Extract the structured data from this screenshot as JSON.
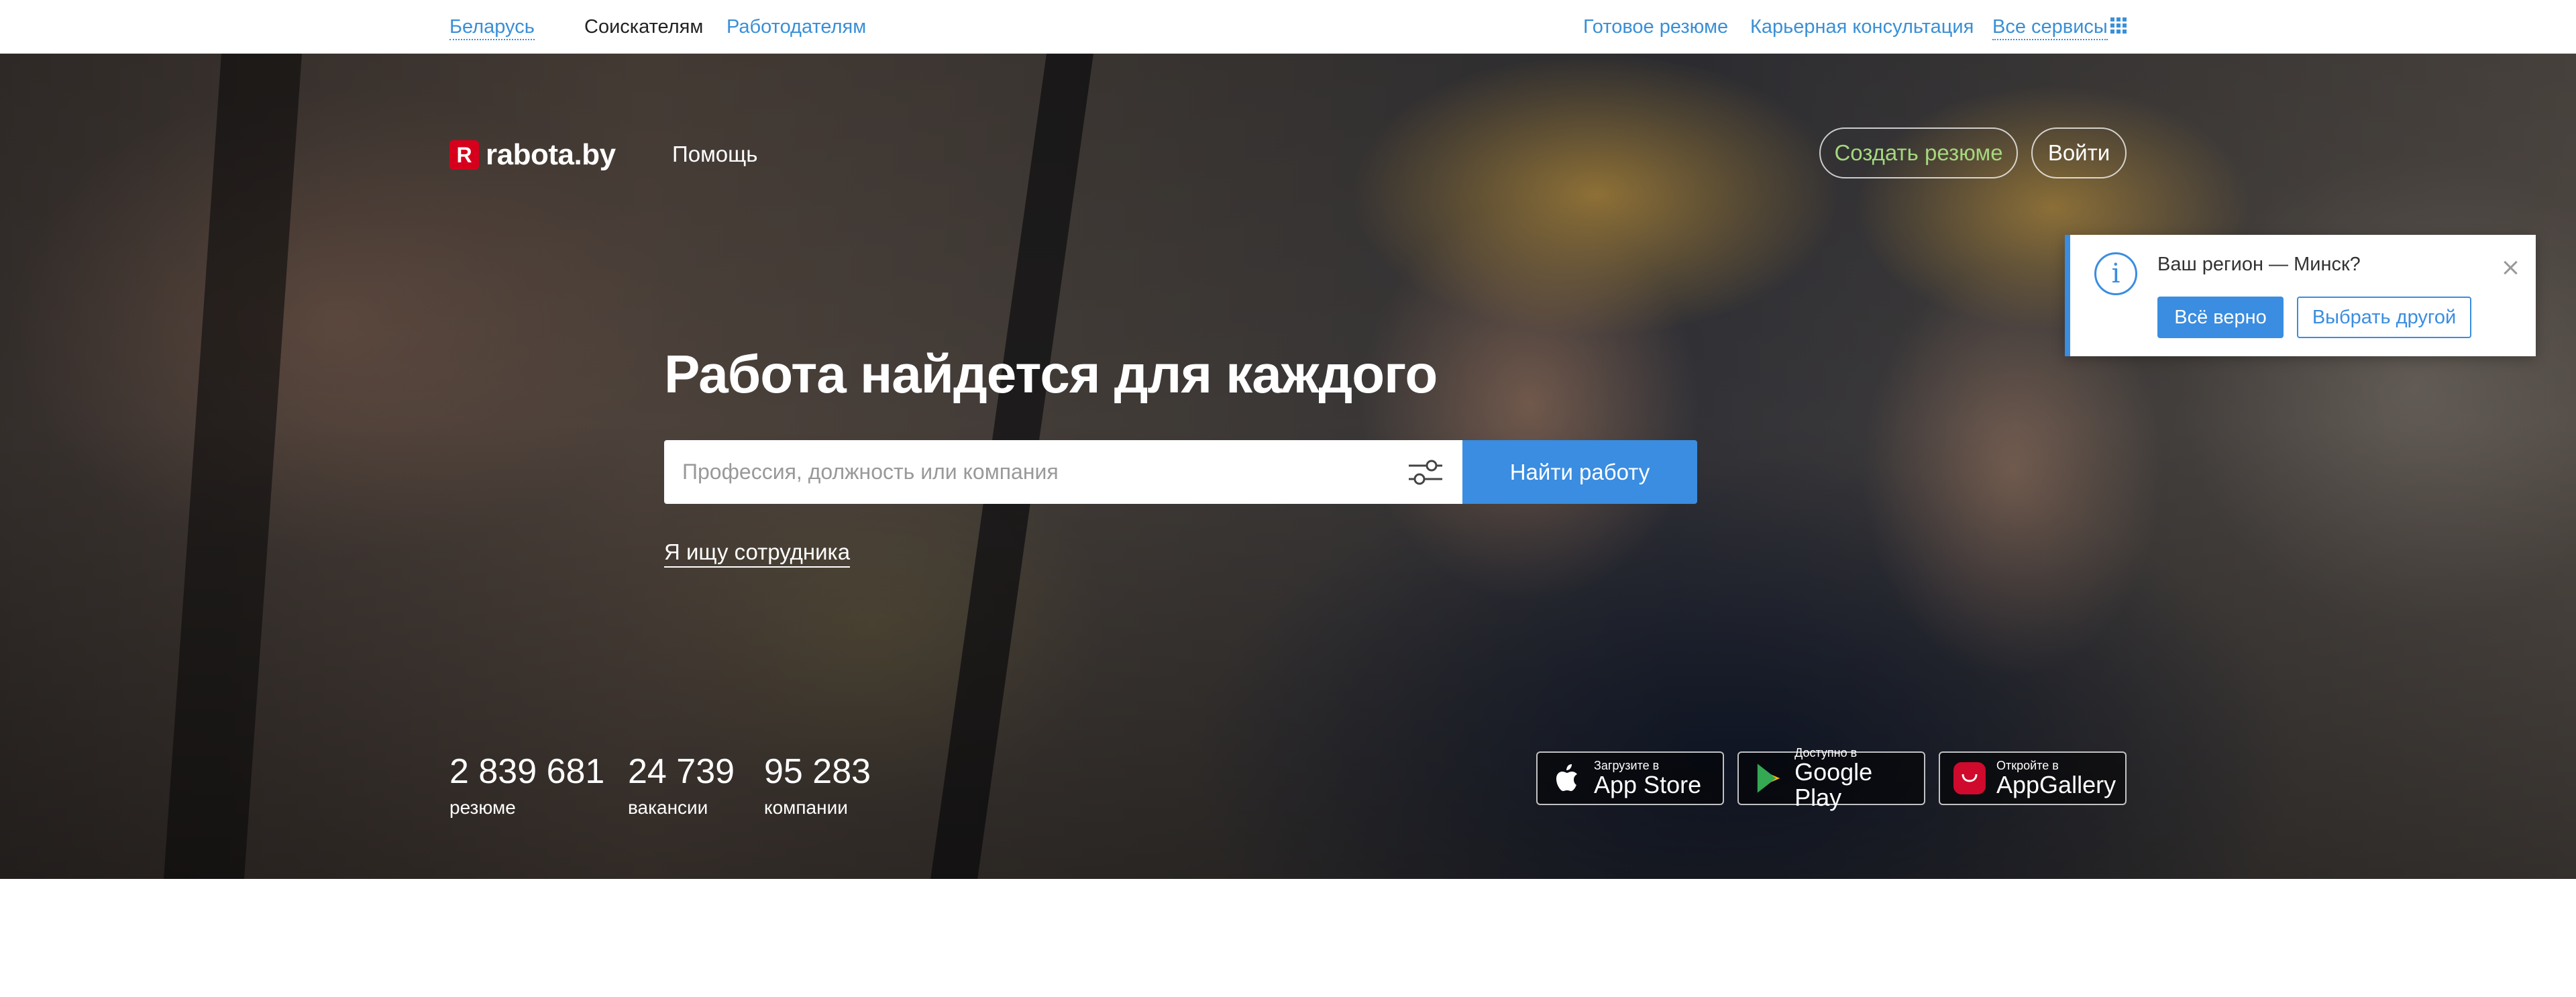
{
  "topbar": {
    "region": "Беларусь",
    "seekers": "Соискателям",
    "employers": "Работодателям",
    "ready_resume": "Готовое резюме",
    "career": "Карьерная консультация",
    "all_services": "Все сервисы"
  },
  "header": {
    "logo_mark": "R",
    "logo_text": "rabota.by",
    "help": "Помощь",
    "create_resume": "Создать резюме",
    "login": "Войти"
  },
  "hero": {
    "headline": "Работа найдется для каждого",
    "search_placeholder": "Профессия, должность или компания",
    "search_value": "",
    "find_button": "Найти работу",
    "employer_link": "Я ищу сотрудника"
  },
  "stats": [
    {
      "number": "2 839 681",
      "label": "резюме"
    },
    {
      "number": "24 739",
      "label": "вакансии"
    },
    {
      "number": "95 283",
      "label": "компании"
    }
  ],
  "stores": [
    {
      "small": "Загрузите в",
      "big": "App Store",
      "icon": "apple-icon"
    },
    {
      "small": "Доступно в",
      "big": "Google Play",
      "icon": "google-play-icon"
    },
    {
      "small": "Откройте в",
      "big": "AppGallery",
      "icon": "huawei-appgallery-icon"
    }
  ],
  "region_popup": {
    "question": "Ваш регион — Минск?",
    "confirm": "Всё верно",
    "choose_other": "Выбрать другой",
    "icon": "info-icon"
  },
  "colors": {
    "accent": "#3a8de0",
    "link": "#3a8fd6",
    "logo_red": "#d6001c",
    "create_resume_text": "#a5d77e"
  }
}
